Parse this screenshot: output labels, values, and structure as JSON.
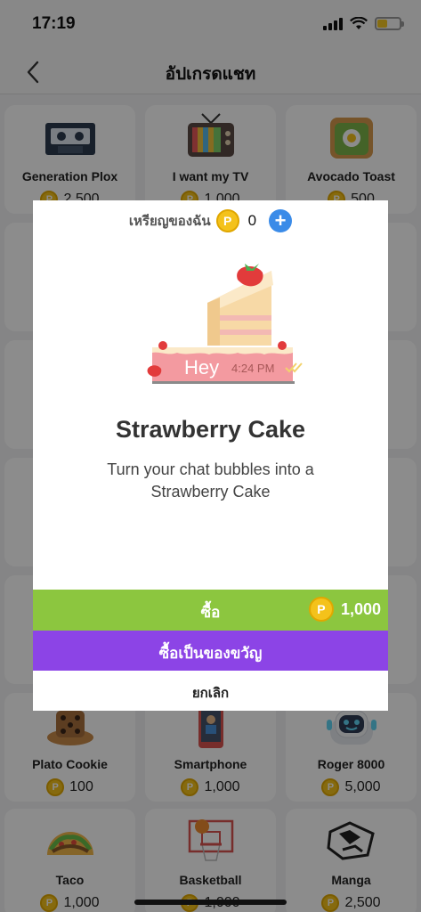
{
  "status": {
    "time": "17:19",
    "battery_color": "#f5c623"
  },
  "nav": {
    "title": "อัปเกรดแชท",
    "back_icon": "chevron-left-icon"
  },
  "tiles": [
    {
      "name": "Generation Plox",
      "price": "2,500",
      "icon": "cassette-icon"
    },
    {
      "name": "I want my TV",
      "price": "1,000",
      "icon": "tv-icon"
    },
    {
      "name": "Avocado Toast",
      "price": "500",
      "icon": "avocado-toast-icon"
    },
    {
      "name": "Plato Cookie",
      "price": "100",
      "icon": "cookie-icon"
    },
    {
      "name": "Smartphone",
      "price": "1,000",
      "icon": "smartphone-icon"
    },
    {
      "name": "Roger 8000",
      "price": "5,000",
      "icon": "robot-icon"
    },
    {
      "name": "Taco",
      "price": "1,000",
      "icon": "taco-icon"
    },
    {
      "name": "Basketball",
      "price": "1,000",
      "icon": "basketball-icon"
    },
    {
      "name": "Manga",
      "price": "2,500",
      "icon": "manga-icon"
    }
  ],
  "modal": {
    "coins_label": "เหรียญของฉัน",
    "coins_value": "0",
    "coin_symbol": "P",
    "preview": {
      "bubble_text": "Hey",
      "bubble_time": "4:24 PM"
    },
    "item_title": "Strawberry Cake",
    "item_desc": "Turn your chat bubbles into a Strawberry Cake",
    "buy_label": "ซื้อ",
    "buy_price": "1,000",
    "gift_label": "ซื้อเป็นของขวัญ",
    "cancel_label": "ยกเลิก",
    "colors": {
      "buy": "#8cc63f",
      "gift": "#8c44e6",
      "coin": "#f4c21b",
      "add": "#3a8be8"
    }
  }
}
